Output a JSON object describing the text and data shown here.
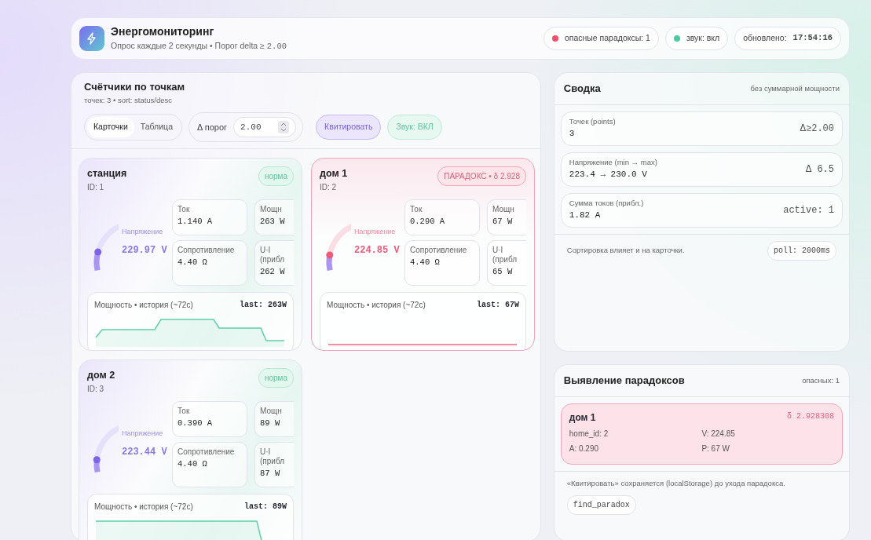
{
  "header": {
    "title": "Энергомониторинг",
    "subtitle": "Опрос каждые 2 секунды • Порог delta ≥ ",
    "subtitle_code": "2.00",
    "pills": [
      {
        "kind": "dot",
        "color": "#f0506e",
        "text": "опасные парадоксы: 1"
      },
      {
        "kind": "dot",
        "color": "#4cc9a0",
        "text": "звук: вкл"
      },
      {
        "kind": "time",
        "label": "обновлено:",
        "value": "17:54:16"
      }
    ]
  },
  "meters": {
    "title": "Счётчики по точкам",
    "subtitle": "точек: 3 • sort: status/desc",
    "views": [
      {
        "label": "Карточки",
        "selected": true
      },
      {
        "label": "Таблица",
        "selected": false
      }
    ],
    "threshold": {
      "label": "Δ порог",
      "value": "2.00"
    },
    "ack_button": "Квитировать",
    "sound_button": "Звук: ВКЛ",
    "cards": [
      {
        "name": "станция",
        "id": "ID: 1",
        "kind": "norm",
        "badge": "норма",
        "gauge": {
          "label": "Напряжение",
          "value": "229.97 V",
          "level": 0.3
        },
        "metrics": [
          {
            "label": "Ток",
            "value": "1.140 A"
          },
          {
            "label": "Мощн",
            "value": "263 W"
          },
          {
            "label": "Сопротивление",
            "value": "4.40 Ω"
          },
          {
            "label": "U·I (прибл",
            "value": "262 W"
          }
        ],
        "history": {
          "label": "Мощность • история (~72с)",
          "last": "last: 263W"
        }
      },
      {
        "name": "дом 1",
        "id": "ID: 2",
        "kind": "paradox",
        "badge": "ПАРАДОКС • δ 2.928",
        "gauge": {
          "label": "Напряжение",
          "value": "224.85 V",
          "level": 0.25
        },
        "metrics": [
          {
            "label": "Ток",
            "value": "0.290 A"
          },
          {
            "label": "Мощн",
            "value": "67 W"
          },
          {
            "label": "Сопротивление",
            "value": "4.40 Ω"
          },
          {
            "label": "U·I (прибл",
            "value": "65 W"
          }
        ],
        "history": {
          "label": "Мощность • история (~72с)",
          "last": "last: 67W"
        }
      },
      {
        "name": "дом 2",
        "id": "ID: 3",
        "kind": "norm",
        "badge": "норма",
        "gauge": {
          "label": "Напряжение",
          "value": "223.44 V",
          "level": 0.2
        },
        "metrics": [
          {
            "label": "Ток",
            "value": "0.390 A"
          },
          {
            "label": "Мощн",
            "value": "89 W"
          },
          {
            "label": "Сопротивление",
            "value": "4.40 Ω"
          },
          {
            "label": "U·I (прибл",
            "value": "87 W"
          }
        ],
        "history": {
          "label": "Мощность • история (~72с)",
          "last": "last: 89W"
        }
      }
    ]
  },
  "summary": {
    "title": "Сводка",
    "note": "без суммарной мощности",
    "items": [
      {
        "label": "Точек (points)",
        "value": "3",
        "aside": "Δ≥2.00"
      },
      {
        "label": "Напряжение (min → max)",
        "value": "223.4 → 230.0 V",
        "aside": "Δ 6.5"
      },
      {
        "label": "Сумма токов (прибл.)",
        "value": "1.82 A",
        "aside": "active: 1"
      }
    ],
    "footer": "Сортировка влияет и на карточки.",
    "footer_pill": "poll: 2000ms"
  },
  "paradoxes": {
    "title": "Выявление парадоксов",
    "count": "опасных: 1",
    "items": [
      {
        "name": "дом 1",
        "delta": "δ 2.928308",
        "fields": [
          "home_id: 2",
          "V: 224.85",
          "A: 0.290",
          "P: 67 W"
        ]
      }
    ],
    "note": "«Квитировать» сохраняется (localStorage) до ухода парадокса.",
    "tag": "find_paradox"
  }
}
